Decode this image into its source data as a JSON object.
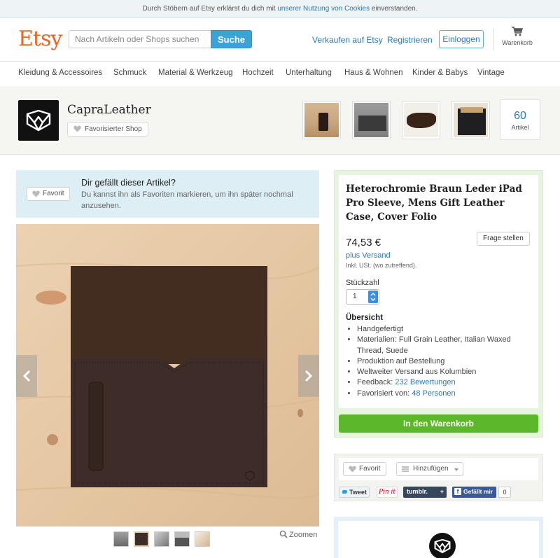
{
  "cookie": {
    "before": "Durch Stöbern auf Etsy erklärst du dich mit ",
    "link": "unserer Nutzung von Cookies",
    "after": " einverstanden."
  },
  "header": {
    "logo": "Etsy",
    "search_placeholder": "Nach Artikeln oder Shops suchen",
    "search_button": "Suche",
    "sell": "Verkaufen auf Etsy",
    "register": "Registrieren",
    "login": "Einloggen",
    "cart": "Warenkorb"
  },
  "categories": [
    "Kleidung & Accessoires",
    "Schmuck",
    "Material & Werkzeug",
    "Hochzeit",
    "Unterhaltung",
    "Haus & Wohnen",
    "Kinder & Babys",
    "Vintage"
  ],
  "shop": {
    "name": "CapraLeather",
    "favorite_label": "Favorisierter Shop",
    "item_count": "60",
    "item_count_label": "Artikel"
  },
  "favorite_banner": {
    "button": "Favorit",
    "title": "Dir gefällt dieser Artikel?",
    "text": "Du kannst ihn als Favoriten markieren, um ihn später nochmal anzusehen."
  },
  "gallery": {
    "zoom": "Zoomen"
  },
  "listing": {
    "title": "Heterochromie Braun Leder iPad Pro Sleeve, Mens Gift Leather Case, Cover Folio",
    "price": "74,53 €",
    "ask_button": "Frage stellen",
    "shipping": "plus Versand",
    "vat": "Inkl. USt. (wo zutreffend).",
    "quantity_label": "Stückzahl",
    "quantity_value": "1",
    "overview_title": "Übersicht",
    "overview": {
      "handmade": "Handgefertigt",
      "materials": "Materialien: Full Grain Leather, Italian Waxed Thread, Suede",
      "production": "Produktion auf Bestellung",
      "shipping": "Weltweiter Versand aus Kolumbien",
      "feedback_label": "Feedback: ",
      "feedback_link": "232 Bewertungen",
      "favorited_label": "Favorisiert von: ",
      "favorited_link": "48 Personen"
    },
    "add_to_cart": "In den Warenkorb"
  },
  "social": {
    "favorite": "Favorit",
    "add": "Hinzufügen",
    "tweet": "Tweet",
    "pinit": "Pin it",
    "tumblr": "tumblr.",
    "tumblr_plus": "+",
    "fb_like": "Gefällt mir",
    "fb_f": "f",
    "fb_count": "0"
  },
  "colors": {
    "etsy_orange": "#f1641e",
    "link_blue": "#2a7bb4",
    "cart_green": "#5cb82a",
    "search_blue": "#3ba4d6"
  }
}
